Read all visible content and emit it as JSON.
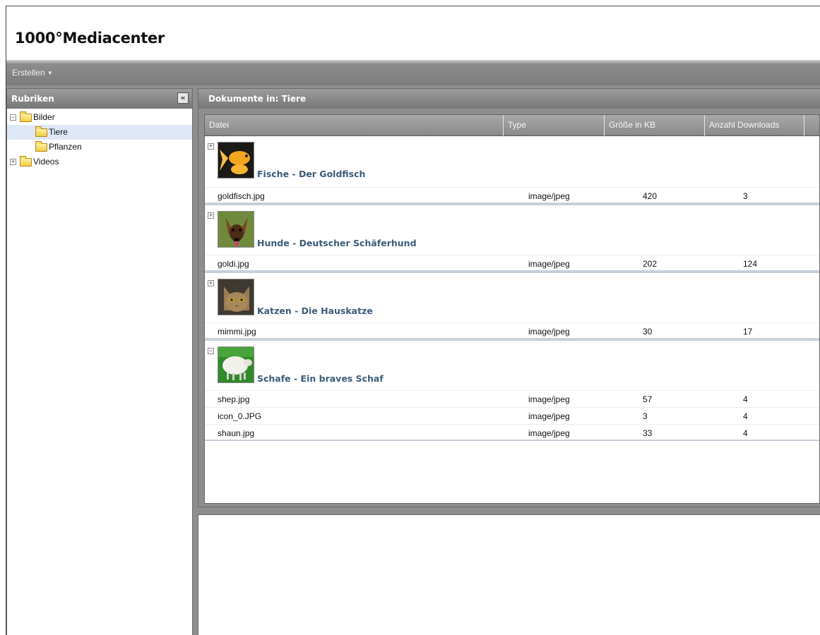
{
  "app": {
    "title": "1000°Mediacenter"
  },
  "toolbar": {
    "create_label": "Erstellen"
  },
  "sidebar": {
    "title": "Rubriken",
    "tree": [
      {
        "label": "Bilder",
        "expanded": true
      },
      {
        "label": "Tiere",
        "selected": true
      },
      {
        "label": "Pflanzen"
      },
      {
        "label": "Videos",
        "expanded": false
      }
    ]
  },
  "main": {
    "title": "Dokumente in: Tiere",
    "columns": [
      "Datei",
      "Type",
      "Größe in KB",
      "Anzahl Downloads"
    ],
    "groups": [
      {
        "title": "Fische - Der Goldfisch",
        "thumbnail": "goldfish",
        "expanded": false,
        "rows": [
          {
            "file": "goldfisch.jpg",
            "type": "image/jpeg",
            "size": "420",
            "downloads": "3"
          }
        ]
      },
      {
        "title": "Hunde - Deutscher Schäferhund",
        "thumbnail": "dog",
        "expanded": false,
        "rows": [
          {
            "file": "goldi.jpg",
            "type": "image/jpeg",
            "size": "202",
            "downloads": "124"
          }
        ]
      },
      {
        "title": "Katzen - Die Hauskatze",
        "thumbnail": "cat",
        "expanded": false,
        "rows": [
          {
            "file": "mimmi.jpg",
            "type": "image/jpeg",
            "size": "30",
            "downloads": "17"
          }
        ]
      },
      {
        "title": "Schafe - Ein braves Schaf",
        "thumbnail": "sheep",
        "expanded": true,
        "rows": [
          {
            "file": "shep.jpg",
            "type": "image/jpeg",
            "size": "57",
            "downloads": "4"
          },
          {
            "file": "icon_0.JPG",
            "type": "image/jpeg",
            "size": "3",
            "downloads": "4"
          },
          {
            "file": "shaun.jpg",
            "type": "image/jpeg",
            "size": "33",
            "downloads": "4"
          }
        ]
      }
    ]
  }
}
